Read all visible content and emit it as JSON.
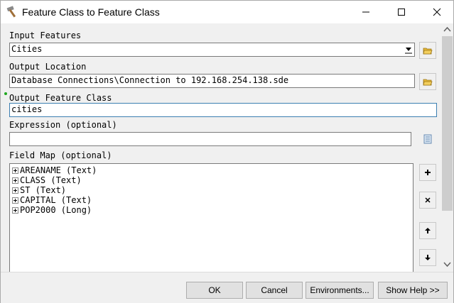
{
  "window": {
    "title": "Feature Class to Feature Class",
    "controls": {
      "minimize": "minimize",
      "maximize": "maximize",
      "close": "close"
    }
  },
  "form": {
    "input_features": {
      "label": "Input Features",
      "value": "Cities"
    },
    "output_location": {
      "label": "Output Location",
      "value": "Database Connections\\Connection to 192.168.254.138.sde"
    },
    "output_feature_class": {
      "label": "Output Feature Class",
      "value": "cities"
    },
    "expression": {
      "label": "Expression (optional)",
      "value": ""
    },
    "field_map": {
      "label": "Field Map (optional)",
      "fields": [
        "AREANAME (Text)",
        "CLASS (Text)",
        "ST (Text)",
        "CAPITAL (Text)",
        "POP2000 (Long)"
      ]
    }
  },
  "buttons": {
    "ok": "OK",
    "cancel": "Cancel",
    "environments": "Environments...",
    "show_help": "Show Help >>"
  },
  "icons": {
    "title": "hammer-icon",
    "browse": "folder-icon",
    "sql": "sql-builder-icon",
    "add": "plus-icon",
    "delete": "x-icon",
    "up": "arrow-up-icon",
    "down": "arrow-down-icon"
  },
  "colors": {
    "focus_border": "#3c7fb1",
    "required_marker": "#1fa81f"
  }
}
